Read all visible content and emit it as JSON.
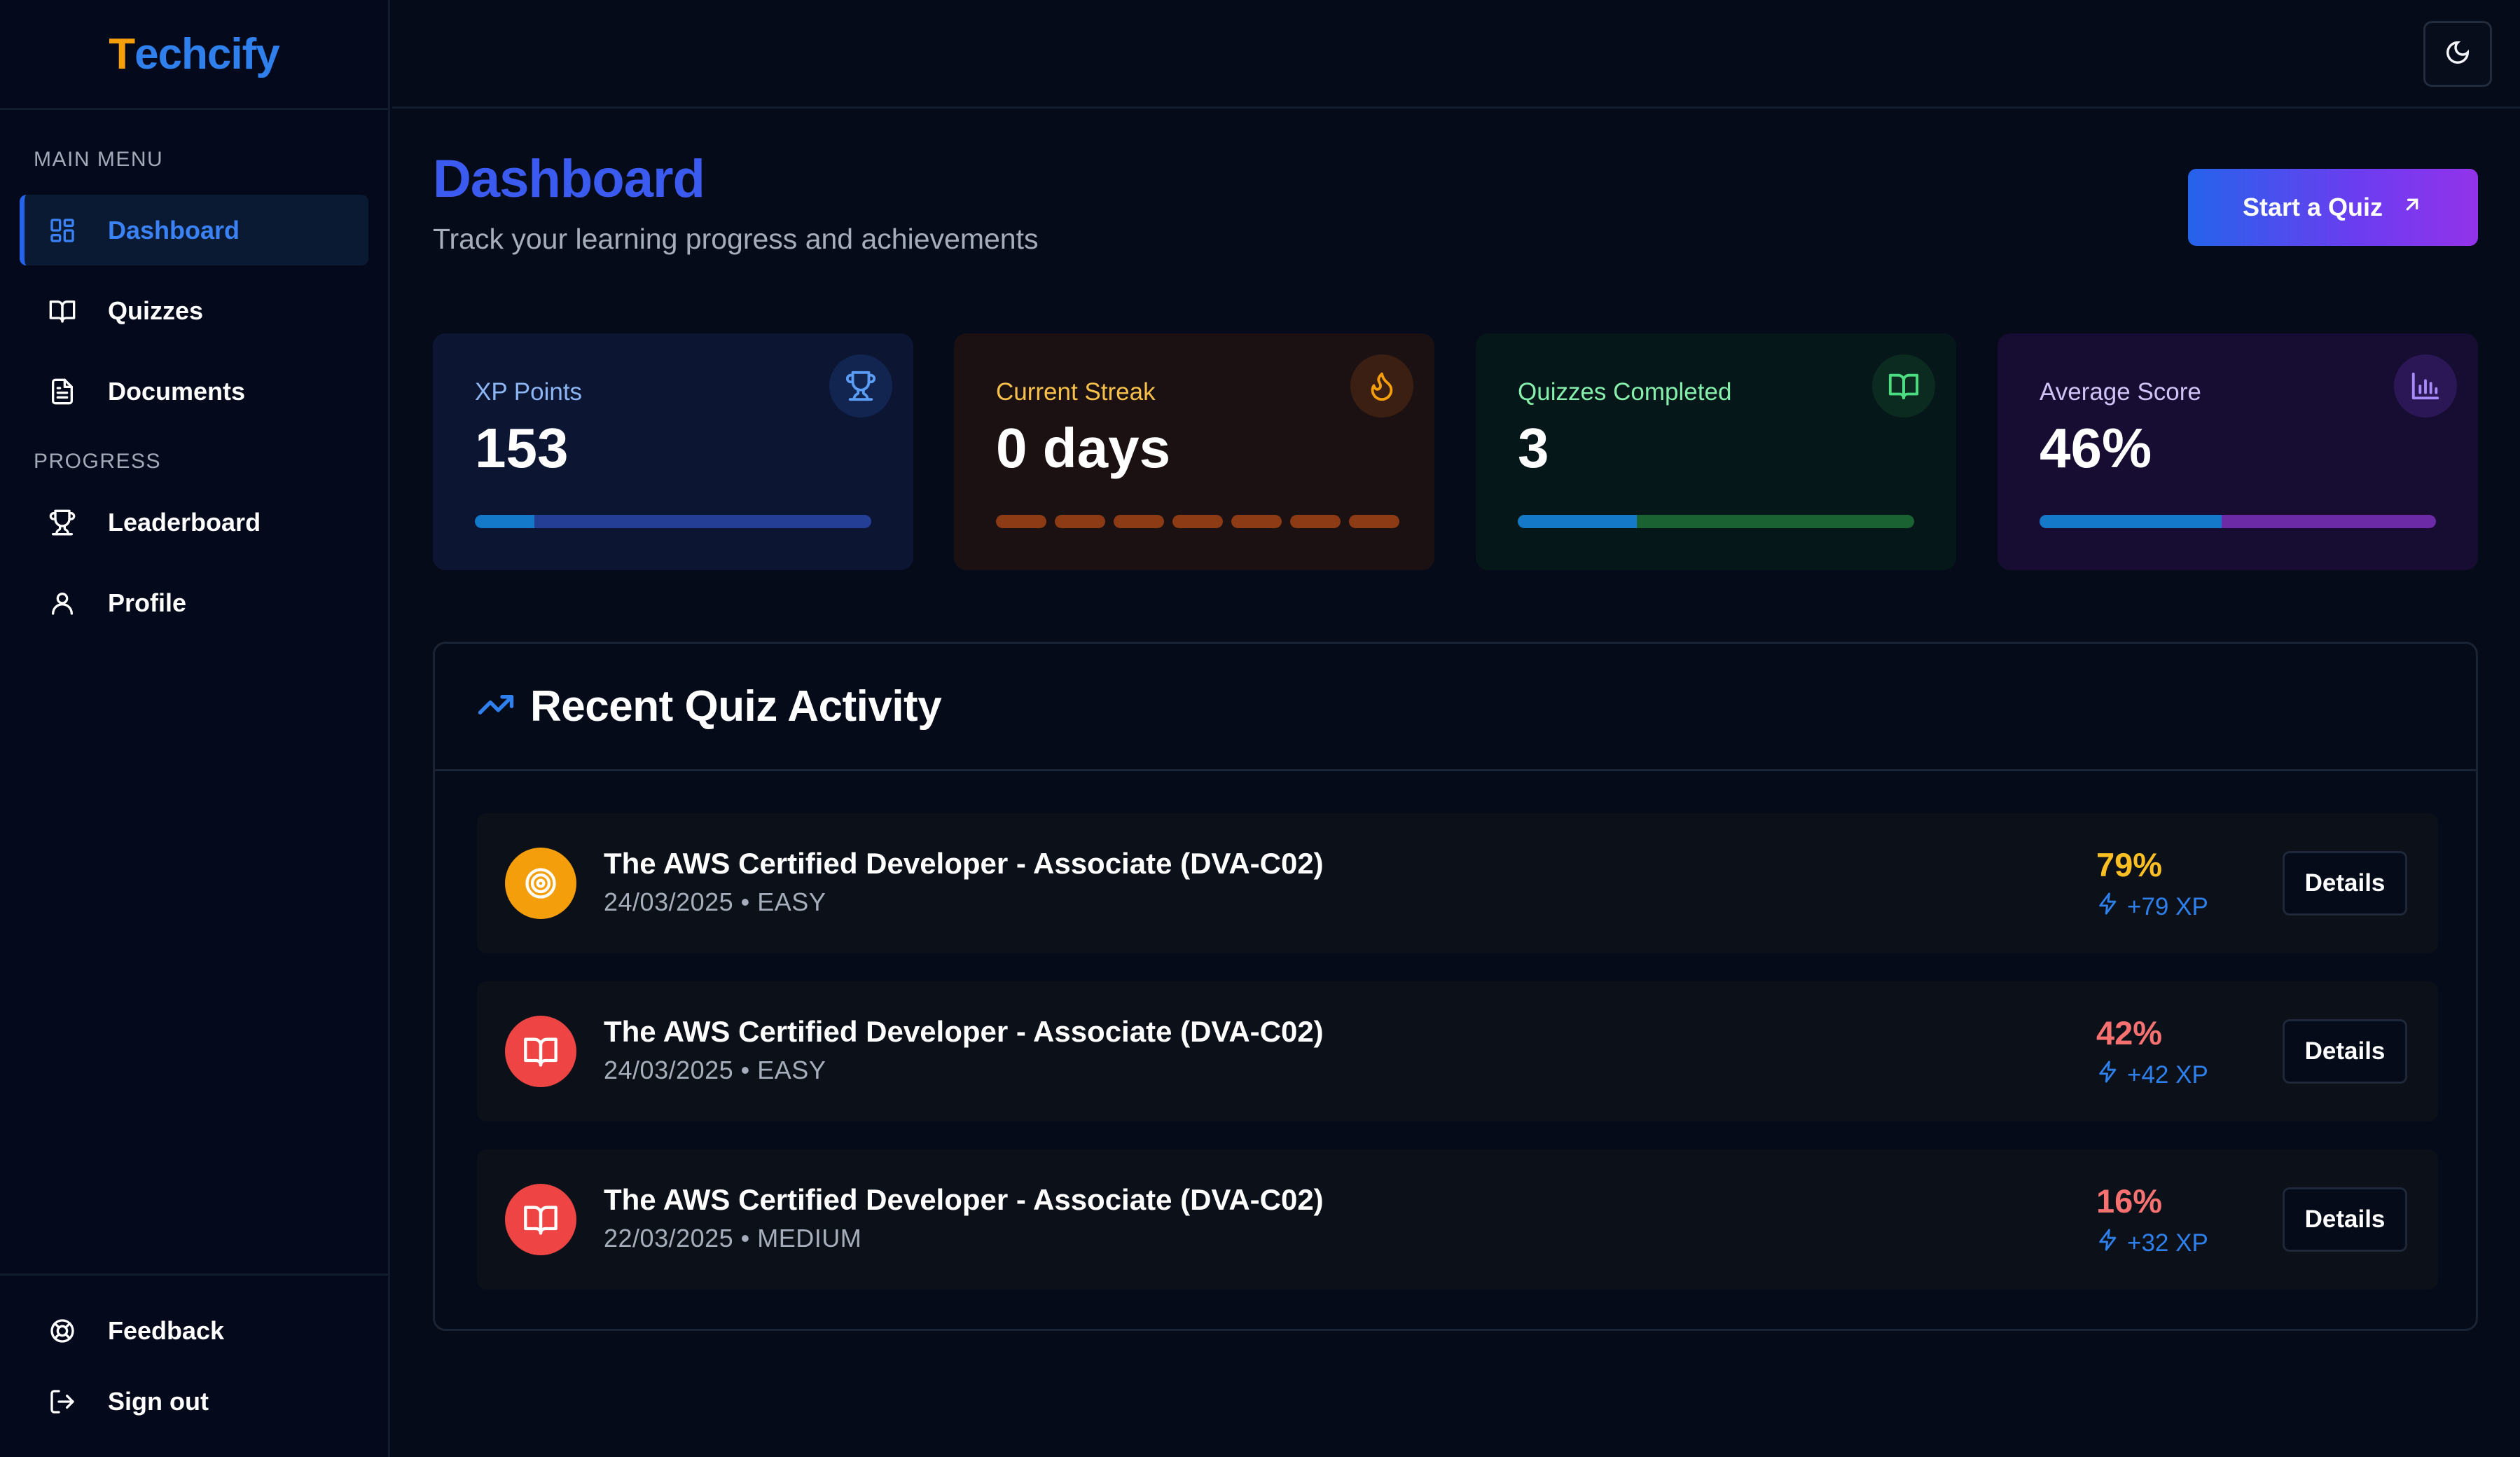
{
  "brand": {
    "first_letter": "T",
    "rest": "echcify"
  },
  "sidebar": {
    "main_menu_label": "MAIN MENU",
    "progress_label": "PROGRESS",
    "items": [
      {
        "label": "Dashboard",
        "icon": "dashboard-grid-icon",
        "active": true
      },
      {
        "label": "Quizzes",
        "icon": "book-open-icon"
      },
      {
        "label": "Documents",
        "icon": "document-icon"
      },
      {
        "label": "Leaderboard",
        "icon": "trophy-icon"
      },
      {
        "label": "Profile",
        "icon": "user-icon"
      }
    ],
    "footer_items": [
      {
        "label": "Feedback",
        "icon": "lifebuoy-icon"
      },
      {
        "label": "Sign out",
        "icon": "sign-out-icon"
      }
    ]
  },
  "topbar": {
    "theme_toggle_icon": "moon-icon"
  },
  "header": {
    "title": "Dashboard",
    "subtitle": "Track your learning progress and achievements",
    "start_quiz_label": "Start a Quiz"
  },
  "stats": [
    {
      "label": "XP Points",
      "value": "153",
      "icon": "trophy-icon",
      "progress": 0.15,
      "color": "#8db6f5"
    },
    {
      "label": "Current Streak",
      "value": "0 days",
      "icon": "flame-icon",
      "segments": 7,
      "color": "#f6c04a"
    },
    {
      "label": "Quizzes Completed",
      "value": "3",
      "icon": "book-open-icon",
      "progress": 0.3,
      "color": "#86efac"
    },
    {
      "label": "Average Score",
      "value": "46%",
      "icon": "bar-chart-icon",
      "progress": 0.46,
      "color": "#d1c2f5"
    }
  ],
  "activity": {
    "title": "Recent Quiz Activity",
    "icon": "trending-up-icon",
    "details_label": "Details",
    "rows": [
      {
        "title": "The AWS Certified Developer - Associate (DVA-C02)",
        "meta": "24/03/2025 • EASY",
        "score": "79%",
        "xp": "+79 XP",
        "score_color": "#fbbf24",
        "avatar_color": "#f59e0b",
        "icon": "target-icon"
      },
      {
        "title": "The AWS Certified Developer - Associate (DVA-C02)",
        "meta": "24/03/2025 • EASY",
        "score": "42%",
        "xp": "+42 XP",
        "score_color": "#f87171",
        "avatar_color": "#ef4444",
        "icon": "book-open-icon"
      },
      {
        "title": "The AWS Certified Developer - Associate (DVA-C02)",
        "meta": "22/03/2025 • MEDIUM",
        "score": "16%",
        "xp": "+32 XP",
        "score_color": "#f87171",
        "avatar_color": "#ef4444",
        "icon": "book-open-icon"
      }
    ]
  }
}
